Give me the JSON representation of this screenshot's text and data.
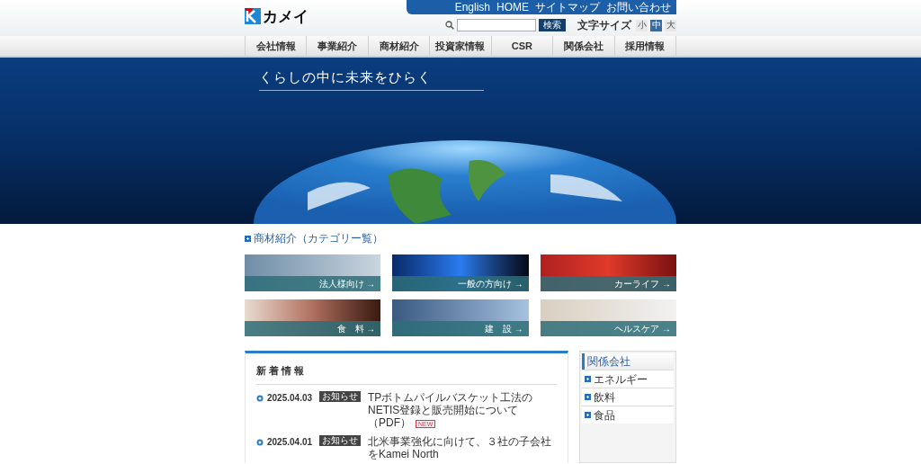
{
  "utility_links": [
    "English",
    "HOME",
    "サイトマップ",
    "お問い合わせ"
  ],
  "logo": {
    "text": "カメイ"
  },
  "search": {
    "button": "検索"
  },
  "font_size": {
    "label": "文字サイズ",
    "options": [
      {
        "label": "小",
        "selected": false
      },
      {
        "label": "中",
        "selected": true
      },
      {
        "label": "大",
        "selected": false
      }
    ]
  },
  "nav": [
    "会社情報",
    "事業紹介",
    "商材紹介",
    "投資家情報",
    "CSR",
    "関係会社",
    "採用情報"
  ],
  "hero": {
    "tagline": "くらしの中に未来をひらく"
  },
  "categories": {
    "heading": "商材紹介（カテゴリー覧）",
    "tiles": [
      {
        "label": "法人様向け →"
      },
      {
        "label": "一般の方向け →"
      },
      {
        "label": "カーライフ →"
      },
      {
        "label": "食　料 →"
      },
      {
        "label": "建　設 →"
      },
      {
        "label": "ヘルスケア →"
      }
    ]
  },
  "news": {
    "title": "新着情報",
    "items": [
      {
        "date": "2025.04.03",
        "tag": "お知らせ",
        "text": "TPボトムパイルバスケット工法のNETIS登録と販売開始について（PDF）",
        "is_new": true,
        "new_label": "NEW"
      },
      {
        "date": "2025.04.01",
        "tag": "お知らせ",
        "text": "北米事業強化に向けて、３社の子会社をKamei North",
        "is_new": false
      }
    ]
  },
  "sidebar": {
    "title": "関係会社",
    "items": [
      "エネルギー",
      "飲料",
      "食品"
    ]
  }
}
